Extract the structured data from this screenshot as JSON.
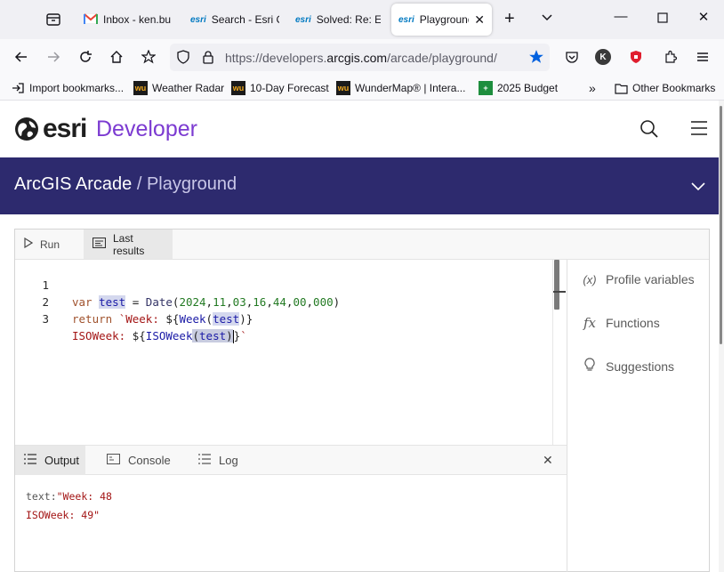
{
  "browser": {
    "tabs": [
      {
        "favicon": "gmail-icon",
        "title": "Inbox - ken.bu",
        "active": false
      },
      {
        "favicon": "esri",
        "title": "Search - Esri C",
        "active": false
      },
      {
        "favicon": "esri",
        "title": "Solved: Re: Ext",
        "active": false
      },
      {
        "favicon": "esri",
        "title": "Playground",
        "active": true
      }
    ],
    "url_prefix": "https://developers.",
    "url_host": "arcgis.com",
    "url_path": "/arcade/playground/",
    "bookmarks": [
      {
        "label": "Import bookmarks..."
      },
      {
        "label": "Weather Radar"
      },
      {
        "label": "10-Day Forecast"
      },
      {
        "label": "WunderMap® | Intera..."
      },
      {
        "label": "2025 Budget"
      }
    ],
    "other_bookmarks": "Other Bookmarks",
    "profile_letter": "K"
  },
  "site": {
    "logo_text": "esri",
    "product": "Developer",
    "banner_title": "ArcGIS Arcade",
    "banner_separator": "/",
    "banner_subtitle": "Playground"
  },
  "toolbar": {
    "run_label": "Run",
    "last_results_label": "Last results"
  },
  "editor": {
    "line_numbers": [
      "1",
      "2",
      "3"
    ]
  },
  "side_panel": {
    "profile_variables": "Profile variables",
    "profile_variables_icon": "(x)",
    "functions": "Functions",
    "functions_icon": "fx",
    "suggestions": "Suggestions"
  },
  "output": {
    "tabs": {
      "output": "Output",
      "console": "Console",
      "log": "Log"
    },
    "line1_key": "text:",
    "line1_value": "\"Week: 48",
    "line2_value": "ISOWeek: 49\""
  }
}
